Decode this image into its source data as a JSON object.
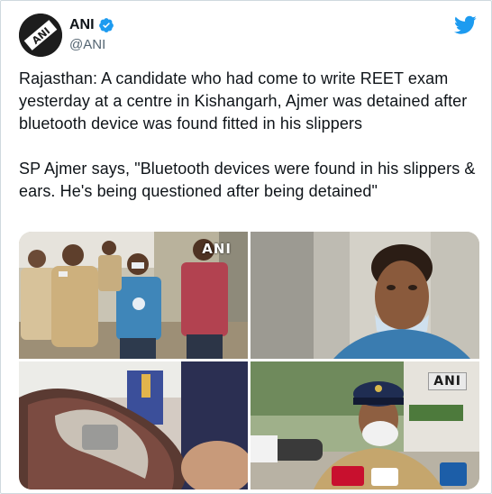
{
  "account": {
    "display_name": "ANI",
    "handle": "@ANI",
    "avatar_text": "ANI",
    "verified": true
  },
  "tweet": {
    "paragraphs": [
      "Rajasthan: A candidate who had come to write REET exam yesterday at a centre in Kishangarh, Ajmer was detained after bluetooth device was found fitted in his slippers",
      "SP Ajmer says, \"Bluetooth devices were found in his slippers & ears. He's being questioned after being detained\""
    ]
  },
  "media": {
    "watermarks": [
      "ANI",
      "ANI"
    ],
    "photos": [
      {
        "subject": "police-escorting-detained-candidate"
      },
      {
        "subject": "candidate-face-closeup"
      },
      {
        "subject": "slipper-with-hidden-device"
      },
      {
        "subject": "sp-ajmer-speaking-to-media"
      }
    ]
  },
  "icons": {
    "brand": "twitter-bird-icon",
    "verified": "verified-badge-icon"
  },
  "colors": {
    "twitter_blue": "#1d9bf0",
    "text": "#0f1419",
    "secondary": "#536471"
  }
}
